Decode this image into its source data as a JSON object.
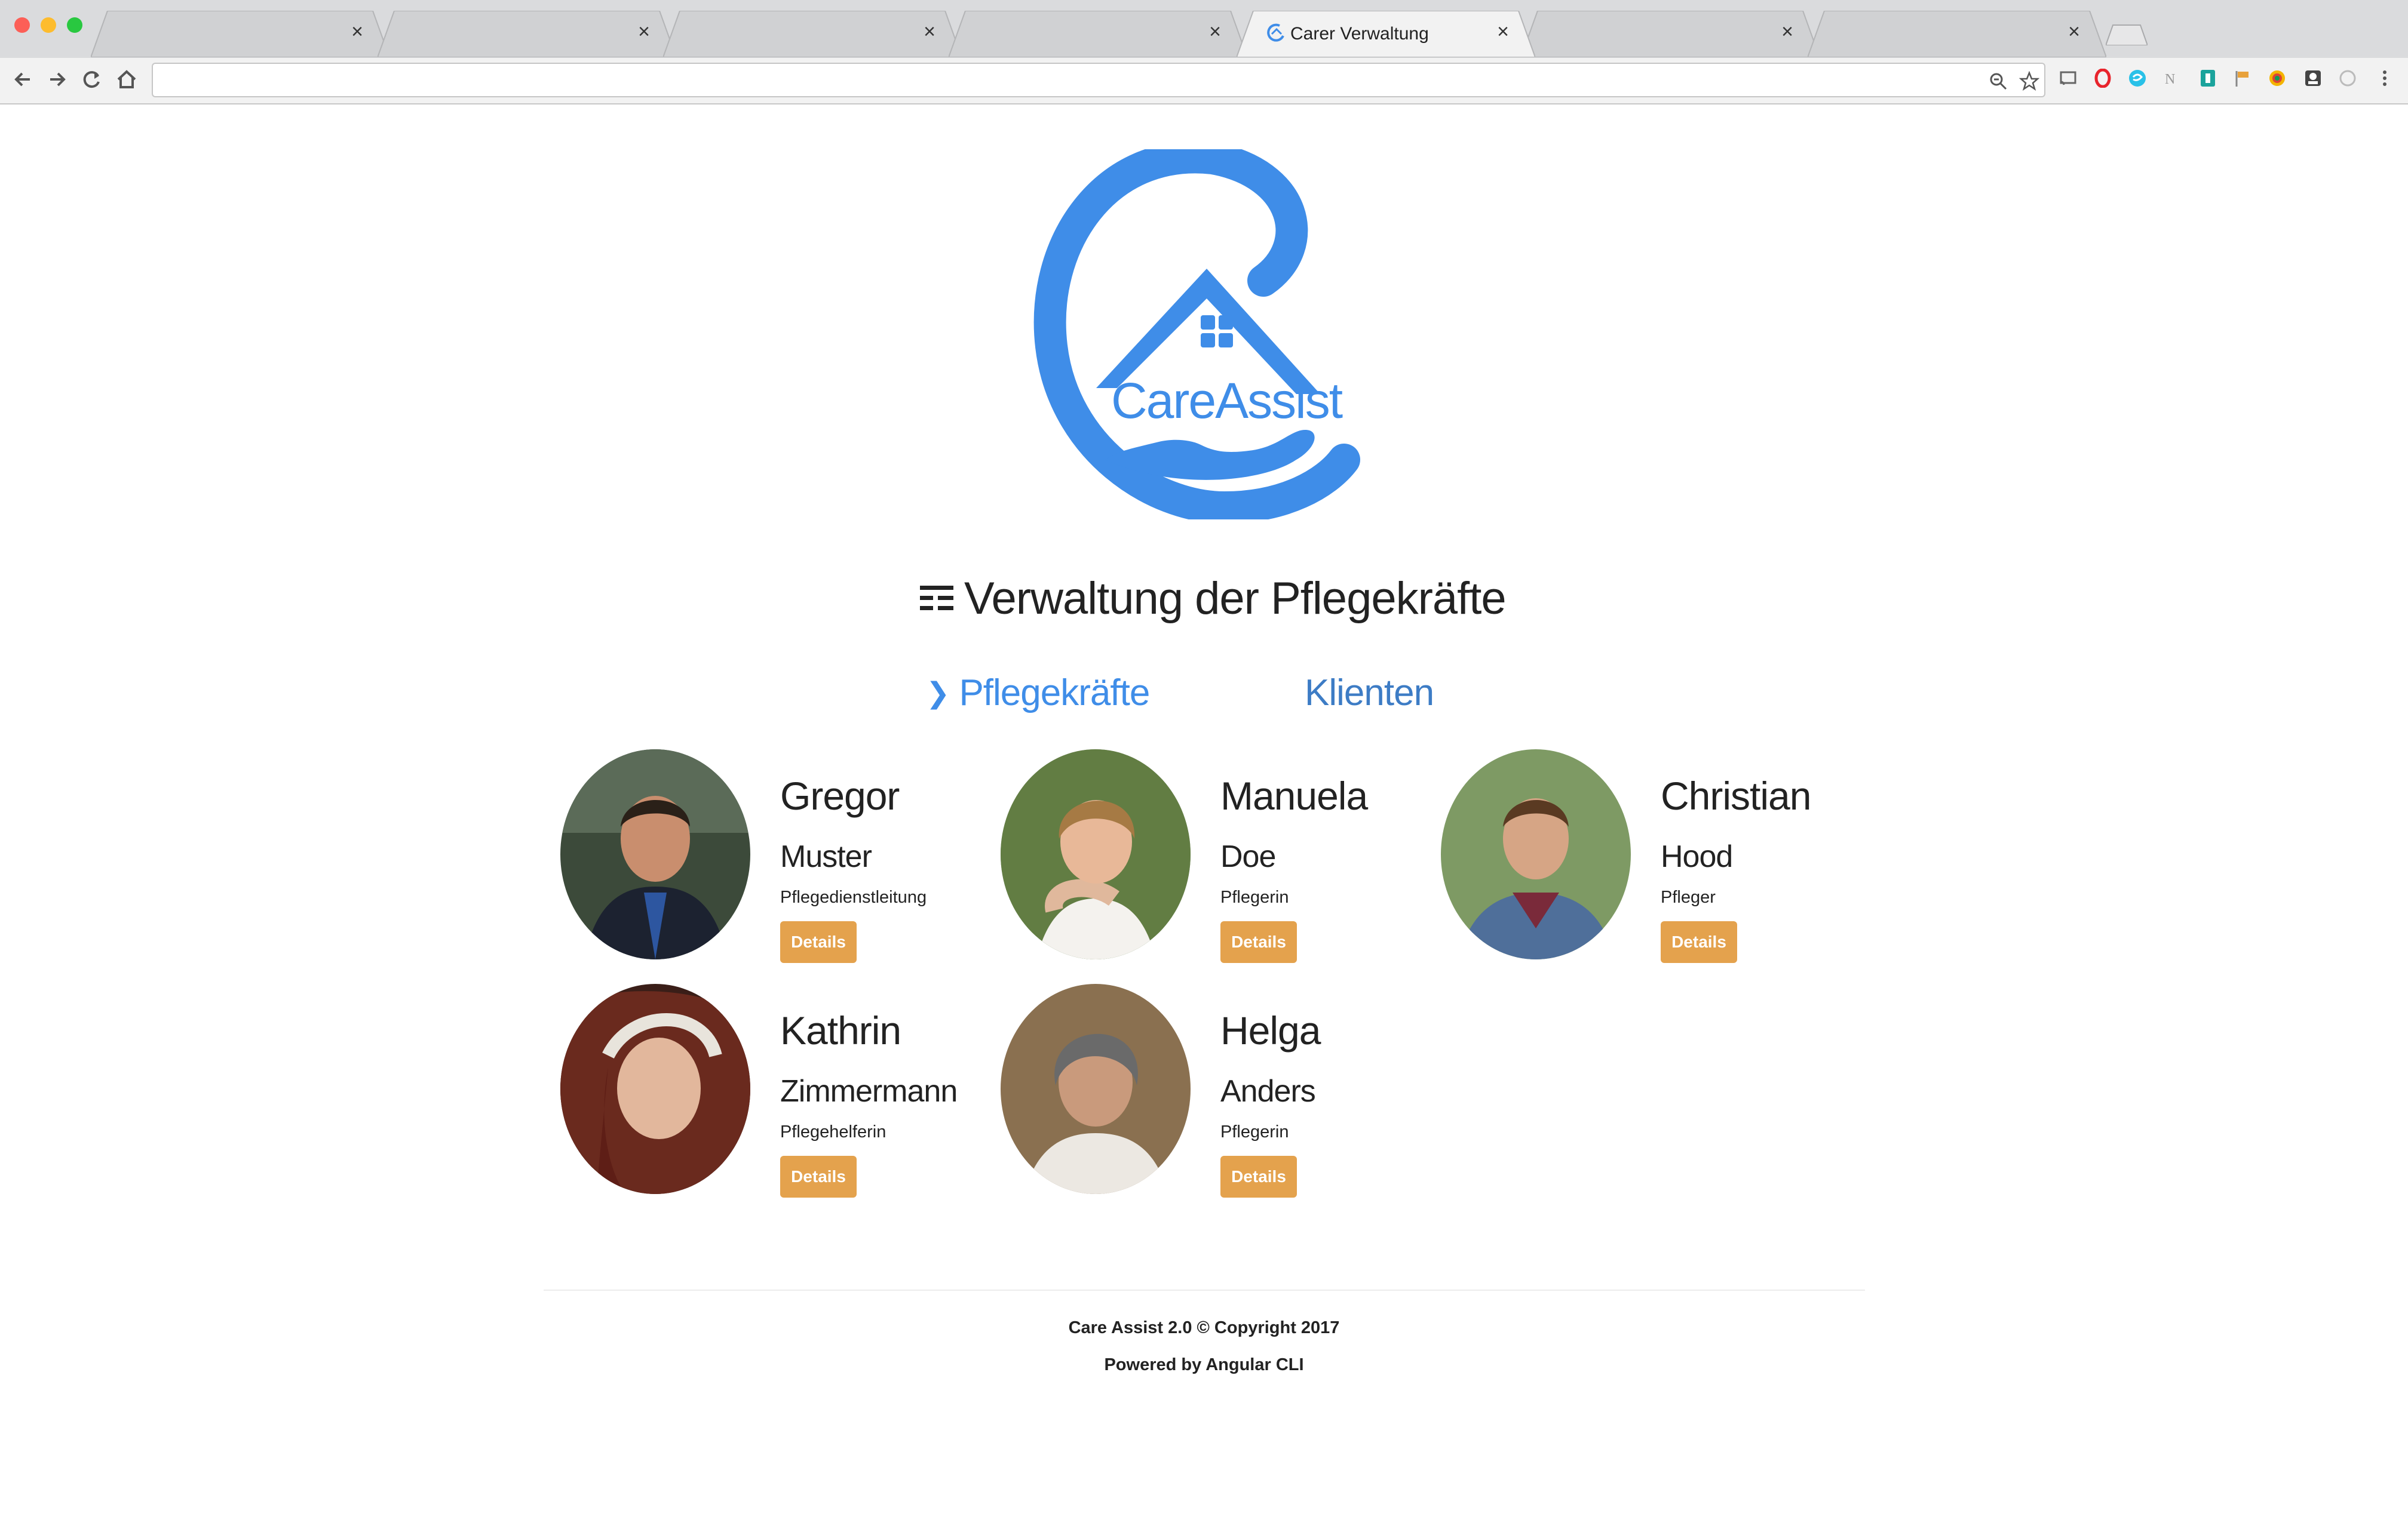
{
  "browser": {
    "tabs": [
      {
        "title": "",
        "active": false
      },
      {
        "title": "",
        "active": false
      },
      {
        "title": "",
        "active": false
      },
      {
        "title": "",
        "active": false
      },
      {
        "title": "Carer Verwaltung",
        "active": true
      },
      {
        "title": "",
        "active": false
      },
      {
        "title": "",
        "active": false
      }
    ],
    "close_glyph": "×",
    "address": ""
  },
  "page": {
    "logo_text": "CareAssist",
    "title": "Verwaltung der Pflegekräfte",
    "nav": {
      "active_marker": "❯",
      "items": [
        {
          "label": "Pflegekräfte",
          "active": true
        },
        {
          "label": "Klienten",
          "active": false
        }
      ]
    },
    "carers": [
      {
        "first": "Gregor",
        "last": "Muster",
        "role": "Pflegedienstleitung",
        "button": "Details"
      },
      {
        "first": "Manuela",
        "last": "Doe",
        "role": "Pflegerin",
        "button": "Details"
      },
      {
        "first": "Christian",
        "last": "Hood",
        "role": "Pfleger",
        "button": "Details"
      },
      {
        "first": "Kathrin",
        "last": "Zimmermann",
        "role": "Pflegehelferin",
        "button": "Details"
      },
      {
        "first": "Helga",
        "last": "Anders",
        "role": "Pflegerin",
        "button": "Details"
      }
    ],
    "footer": {
      "line1": "Care Assist 2.0 © Copyright 2017",
      "line2": "Powered by Angular CLI"
    }
  },
  "colors": {
    "brand_blue": "#3f8de8",
    "button_orange": "#e4a24d"
  },
  "icons": [
    "back-icon",
    "forward-icon",
    "reload-icon",
    "home-icon",
    "zoom-icon",
    "star-icon",
    "list-icon"
  ]
}
